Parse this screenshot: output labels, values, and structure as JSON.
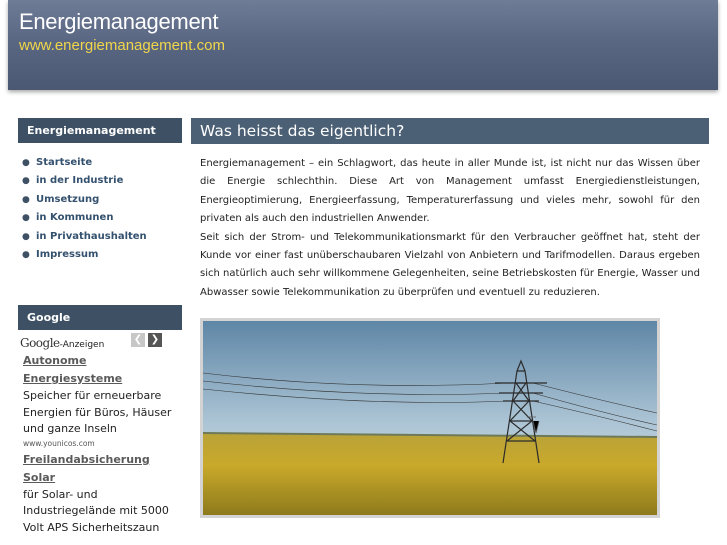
{
  "header": {
    "title": "Energiemanagement",
    "url": "www.energiemanagement.com"
  },
  "sidebar": {
    "nav_title": "Energiemanagement",
    "items": [
      {
        "label": "Startseite"
      },
      {
        "label": "in der Industrie"
      },
      {
        "label": "Umsetzung"
      },
      {
        "label": "in Kommunen"
      },
      {
        "label": "in Privathaushalten"
      },
      {
        "label": "Impressum"
      }
    ],
    "google_title": "Google",
    "google_logo_text": "Google",
    "google_ads_label": "-Anzeigen",
    "ads": [
      {
        "title": "Autonome Energiesysteme",
        "text": "Speicher für erneuerbare Energien für Büros, Häuser und ganze Inseln",
        "url": "www.younicos.com"
      },
      {
        "title": "Freilandabsicherung Solar",
        "text": "für Solar- und Industriegelände mit 5000 Volt APS Sicherheitszaun"
      }
    ]
  },
  "main": {
    "title": "Was heisst das eigentlich?",
    "paragraph1": "Energiemanagement – ein Schlagwort, das heute in aller Munde ist, ist nicht nur das Wissen über die Energie schlechthin. Diese Art von Management umfasst Energiedienstleistungen, Energieoptimierung, Energieerfassung, Temperaturerfassung und vieles mehr, sowohl für den privaten als auch den industriellen Anwender.",
    "paragraph2": "Seit sich der Strom- und Telekommunikationsmarkt für den Verbraucher geöffnet hat, steht der Kunde vor einer fast unüberschaubaren Vielzahl von Anbietern und Tarifmodellen. Daraus ergeben sich natürlich auch sehr willkommene Gelegenheiten, seine Betriebskosten für Energie, Wasser und Abwasser sowie Telekommunikation zu überprüfen und eventuell zu reduzieren."
  },
  "colors": {
    "header_bg": "#5a6783",
    "header_url": "#f0d64a",
    "box_head": "#3e5164",
    "main_head": "#4b6075",
    "link": "#34516e"
  },
  "icons": {
    "prev": "chevron-left-icon",
    "next": "chevron-right-icon",
    "bullet": "bullet-icon"
  }
}
